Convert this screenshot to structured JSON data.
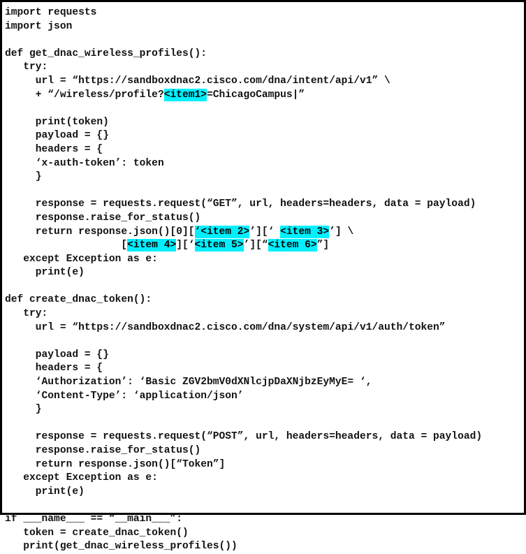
{
  "document": {
    "kind": "python-code-listing",
    "language": "Python",
    "frame_border_color": "#000000",
    "background_color": "#ffffff",
    "text_color": "#121212",
    "highlight_color": "#00f0ff",
    "highlight_labels": [
      "<item1>",
      "<item 2>",
      "<item 3>",
      "<item 4>",
      "<item 5>",
      "<item 6>"
    ]
  },
  "code": {
    "lines": [
      {
        "id": "l01",
        "segments": [
          {
            "t": "import requests"
          }
        ]
      },
      {
        "id": "l02",
        "segments": [
          {
            "t": "import json"
          }
        ]
      },
      {
        "id": "l03",
        "segments": [
          {
            "t": ""
          }
        ]
      },
      {
        "id": "l04",
        "segments": [
          {
            "t": "def get_dnac_wireless_profiles():"
          }
        ]
      },
      {
        "id": "l05",
        "segments": [
          {
            "t": "   try:"
          }
        ]
      },
      {
        "id": "l06",
        "segments": [
          {
            "t": "     url = “https://sandboxdnac2.cisco.com/dna/intent/api/v1” \\"
          }
        ]
      },
      {
        "id": "l07",
        "segments": [
          {
            "t": "     + “/wireless/profile?"
          },
          {
            "t": "<item1>",
            "hl": true
          },
          {
            "t": "=ChicagoCampus|”"
          }
        ]
      },
      {
        "id": "l08",
        "segments": [
          {
            "t": ""
          }
        ]
      },
      {
        "id": "l09",
        "segments": [
          {
            "t": "     print(token)"
          }
        ]
      },
      {
        "id": "l10",
        "segments": [
          {
            "t": "     payload = {}"
          }
        ]
      },
      {
        "id": "l11",
        "segments": [
          {
            "t": "     headers = {"
          }
        ]
      },
      {
        "id": "l12",
        "segments": [
          {
            "t": "     ‘x-auth-token’: token"
          }
        ]
      },
      {
        "id": "l13",
        "segments": [
          {
            "t": "     }"
          }
        ]
      },
      {
        "id": "l14",
        "segments": [
          {
            "t": ""
          }
        ]
      },
      {
        "id": "l15",
        "segments": [
          {
            "t": "     response = requests.request(“GET”, url, headers=headers, data = payload)"
          }
        ]
      },
      {
        "id": "l16",
        "segments": [
          {
            "t": "     response.raise_for_status()"
          }
        ]
      },
      {
        "id": "l17",
        "segments": [
          {
            "t": "     return response.json()[0]["
          },
          {
            "t": "‘<item 2>",
            "hl": true
          },
          {
            "t": "’][‘ "
          },
          {
            "t": "<item 3>",
            "hl": true
          },
          {
            "t": "’] \\"
          }
        ]
      },
      {
        "id": "l18",
        "segments": [
          {
            "t": "                   ["
          },
          {
            "t": "<item 4>",
            "hl": true
          },
          {
            "t": "][‘"
          },
          {
            "t": "<item 5>",
            "hl": true
          },
          {
            "t": "’][“"
          },
          {
            "t": "<item 6>",
            "hl": true
          },
          {
            "t": "”]"
          }
        ]
      },
      {
        "id": "l19",
        "segments": [
          {
            "t": "   except Exception as e:"
          }
        ]
      },
      {
        "id": "l20",
        "segments": [
          {
            "t": "     print(e)"
          }
        ]
      },
      {
        "id": "l21",
        "segments": [
          {
            "t": ""
          }
        ]
      },
      {
        "id": "l22",
        "segments": [
          {
            "t": "def create_dnac_token():"
          }
        ]
      },
      {
        "id": "l23",
        "segments": [
          {
            "t": "   try:"
          }
        ]
      },
      {
        "id": "l24",
        "segments": [
          {
            "t": "     url = “https://sandboxdnac2.cisco.com/dna/system/api/v1/auth/token”"
          }
        ]
      },
      {
        "id": "l25",
        "segments": [
          {
            "t": ""
          }
        ]
      },
      {
        "id": "l26",
        "segments": [
          {
            "t": "     payload = {}"
          }
        ]
      },
      {
        "id": "l27",
        "segments": [
          {
            "t": "     headers = {"
          }
        ]
      },
      {
        "id": "l28",
        "segments": [
          {
            "t": "     ‘Authorization’: ‘Basic ZGV2bmV0dXNlcjpDaXNjbzEyMyE= ‘,"
          }
        ]
      },
      {
        "id": "l29",
        "segments": [
          {
            "t": "     ‘Content-Type’: ‘application/json’"
          }
        ]
      },
      {
        "id": "l30",
        "segments": [
          {
            "t": "     }"
          }
        ]
      },
      {
        "id": "l31",
        "segments": [
          {
            "t": ""
          }
        ]
      },
      {
        "id": "l32",
        "segments": [
          {
            "t": "     response = requests.request(“POST”, url, headers=headers, data = payload)"
          }
        ]
      },
      {
        "id": "l33",
        "segments": [
          {
            "t": "     response.raise_for_status()"
          }
        ]
      },
      {
        "id": "l34",
        "segments": [
          {
            "t": "     return response.json()[“Token”]"
          }
        ]
      },
      {
        "id": "l35",
        "segments": [
          {
            "t": "   except Exception as e:"
          }
        ]
      },
      {
        "id": "l36",
        "segments": [
          {
            "t": "     print(e)"
          }
        ]
      },
      {
        "id": "l37",
        "segments": [
          {
            "t": ""
          }
        ]
      },
      {
        "id": "l38",
        "segments": [
          {
            "t": "if ___name___ == “__main___”:"
          }
        ]
      },
      {
        "id": "l39",
        "segments": [
          {
            "t": "   token = create_dnac_token()"
          }
        ]
      },
      {
        "id": "l40",
        "segments": [
          {
            "t": "   print(get_dnac_wireless_profiles())"
          }
        ]
      }
    ]
  }
}
